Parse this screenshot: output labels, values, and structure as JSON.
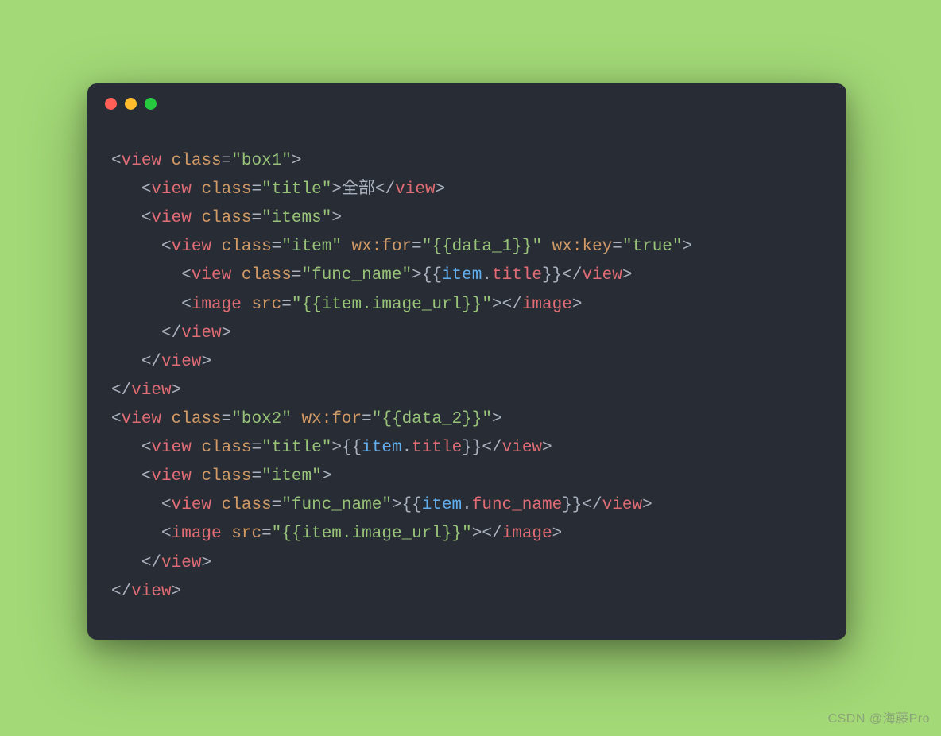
{
  "colors": {
    "background": "#a3d977",
    "editor_bg": "#282c34",
    "traffic_red": "#ff5f56",
    "traffic_yellow": "#ffbd2e",
    "traffic_green": "#27c93f",
    "punct": "#abb2bf",
    "tag": "#e06c75",
    "attr": "#d19a66",
    "string": "#98c379",
    "variable": "#61afef",
    "property": "#e06c75",
    "text": "#abb2bf"
  },
  "watermark": "CSDN @海藤Pro",
  "code": {
    "tags": {
      "view": "view",
      "image": "image"
    },
    "attrs": {
      "class": "class",
      "wx_for": "wx:for",
      "wx_key": "wx:key",
      "src": "src"
    },
    "eq": "=",
    "quote": "\"",
    "lt": "<",
    "lt_close": "</",
    "gt": ">",
    "strings": {
      "box1": "box1",
      "box2": "box2",
      "title": "title",
      "items": "items",
      "item": "item",
      "func_name": "func_name",
      "true": "true"
    },
    "text_literal": "全部",
    "expr": {
      "open": "{{",
      "close": "}}",
      "item": "item",
      "dot": ".",
      "title": "title",
      "image_url": "image_url",
      "func_name": "func_name",
      "data_1": "data_1",
      "data_2": "data_2"
    }
  }
}
